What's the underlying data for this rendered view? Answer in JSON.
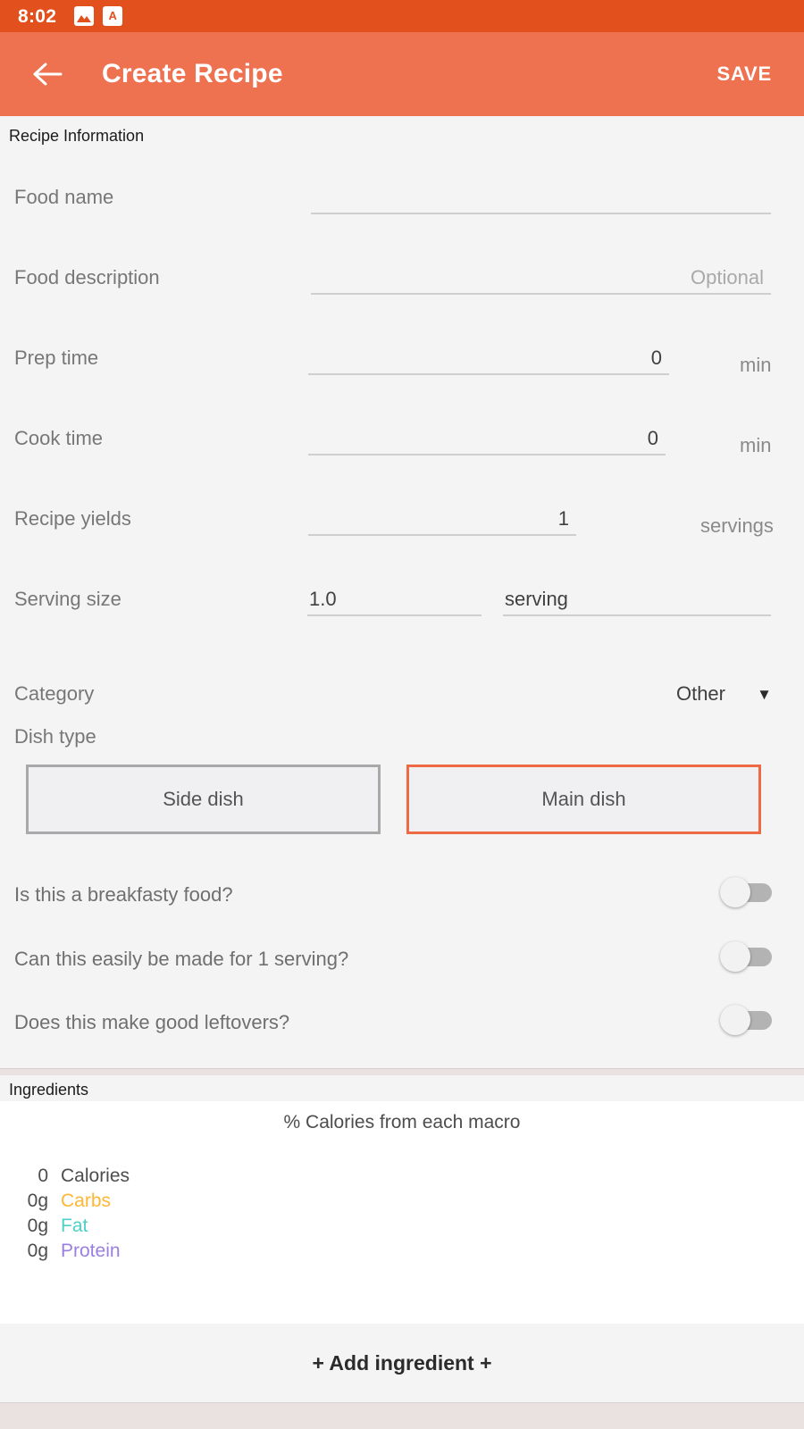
{
  "status_bar": {
    "time": "8:02",
    "icons": [
      {
        "name": "image-icon",
        "glyph": "image"
      },
      {
        "name": "app-letter-icon",
        "glyph": "A"
      }
    ]
  },
  "app_bar": {
    "back_icon": "back-arrow-icon",
    "title": "Create Recipe",
    "save_label": "SAVE",
    "background": "#ee7150",
    "status_background": "#e2501e"
  },
  "recipe_section": {
    "header": "Recipe Information",
    "fields": [
      {
        "label": "Food name",
        "value": "",
        "placeholder": "",
        "unit": ""
      },
      {
        "label": "Food description",
        "value": "",
        "placeholder": "Optional",
        "unit": ""
      },
      {
        "label": "Prep time",
        "value": "0",
        "placeholder": "",
        "unit": "min"
      },
      {
        "label": "Cook time",
        "value": "0",
        "placeholder": "",
        "unit": "min"
      },
      {
        "label": "Recipe yields",
        "value": "1",
        "placeholder": "",
        "unit": "servings"
      }
    ],
    "serving_size": {
      "label": "Serving size",
      "amount": "1.0",
      "unit_text": "serving"
    },
    "category": {
      "label": "Category",
      "selected": "Other",
      "caret": "▼"
    },
    "dish_type": {
      "label": "Dish type",
      "options": [
        {
          "label": "Side dish",
          "selected": false
        },
        {
          "label": "Main dish",
          "selected": true
        }
      ],
      "selected_color": "#ee6a45",
      "unselected_color": "#a9a9a9"
    },
    "questions": [
      {
        "label": "Is this a breakfasty food?",
        "on": false
      },
      {
        "label": "Can this easily be made for 1 serving?",
        "on": false
      },
      {
        "label": "Does this make good leftovers?",
        "on": false
      }
    ]
  },
  "ingredients_section": {
    "header": "Ingredients",
    "macro_title": "% Calories from each macro",
    "macros": [
      {
        "amount": "0",
        "name": "Calories",
        "color": "#4d4d4d"
      },
      {
        "amount": "0g",
        "name": "Carbs",
        "color": "#ffb733"
      },
      {
        "amount": "0g",
        "name": "Fat",
        "color": "#4dd0c8"
      },
      {
        "amount": "0g",
        "name": "Protein",
        "color": "#9b7fe0"
      }
    ],
    "add_button": "+ Add ingredient +"
  }
}
